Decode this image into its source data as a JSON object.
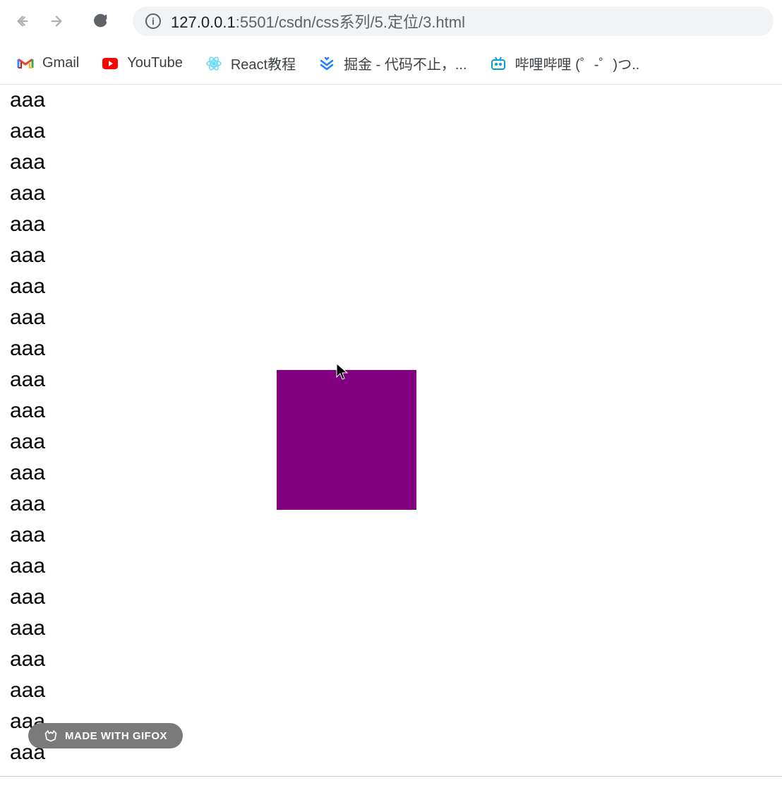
{
  "nav": {
    "url_host": "127.0.0.1",
    "url_port": ":5501",
    "url_path": "/csdn/css系列/5.定位/3.html"
  },
  "bookmarks": [
    {
      "label": "Gmail",
      "icon": "gmail"
    },
    {
      "label": "YouTube",
      "icon": "youtube"
    },
    {
      "label": "React教程",
      "icon": "react"
    },
    {
      "label": "掘金 - 代码不止，...",
      "icon": "juejin"
    },
    {
      "label": "哔哩哔哩 (゜-゜)つ..",
      "icon": "bilibili"
    }
  ],
  "page": {
    "text_line": "aaa",
    "line_count": 22,
    "box_color": "#800080"
  },
  "badge": {
    "label": "MADE WITH GIFOX"
  }
}
